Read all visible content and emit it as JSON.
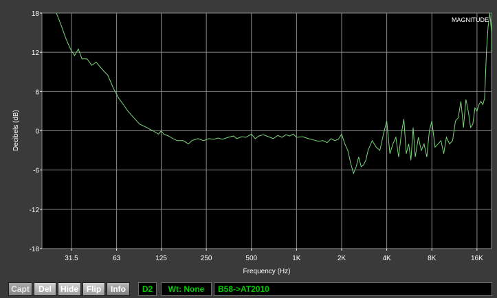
{
  "chart_data": {
    "type": "line",
    "title": "MAGNITUDE",
    "xlabel": "Frequency (Hz)",
    "ylabel": "Decibels (dB)",
    "x_scale": "log",
    "xlim": [
      20,
      20000
    ],
    "ylim": [
      -18,
      18
    ],
    "x_ticks": [
      31.5,
      63,
      125,
      250,
      500,
      1000,
      2000,
      4000,
      8000,
      16000
    ],
    "x_tick_labels": [
      "31.5",
      "63",
      "125",
      "250",
      "500",
      "1K",
      "2K",
      "4K",
      "8K",
      "16K"
    ],
    "y_ticks": [
      18,
      12,
      6,
      0,
      -6,
      -12,
      -18
    ],
    "y_tick_labels": [
      "18",
      "12",
      "6",
      "0",
      "-6",
      "-12",
      "-18"
    ],
    "grid": true,
    "colors": {
      "background": "#000000",
      "grid": "#8c8c8c",
      "line": "#7cd67c",
      "text": "#ffffff"
    },
    "series": [
      {
        "x": [
          25,
          27,
          29,
          31,
          33,
          35,
          37,
          40,
          43,
          46,
          50,
          55,
          60,
          65,
          70,
          75,
          82,
          90,
          100,
          110,
          120,
          125,
          130,
          140,
          150,
          160,
          175,
          190,
          200,
          220,
          240,
          260,
          280,
          300,
          320,
          350,
          380,
          400,
          430,
          460,
          500,
          530,
          560,
          600,
          650,
          700,
          750,
          800,
          850,
          900,
          950,
          1000,
          1100,
          1200,
          1300,
          1400,
          1500,
          1600,
          1700,
          1800,
          1900,
          2000,
          2100,
          2200,
          2300,
          2400,
          2500,
          2600,
          2700,
          2800,
          2900,
          3000,
          3200,
          3400,
          3600,
          3800,
          4000,
          4200,
          4400,
          4600,
          4800,
          5000,
          5200,
          5400,
          5600,
          5800,
          6000,
          6200,
          6500,
          6800,
          7100,
          7400,
          7700,
          8000,
          8400,
          8800,
          9200,
          9600,
          10000,
          10500,
          11000,
          11500,
          12000,
          12500,
          13000,
          13500,
          14000,
          14500,
          15000,
          15500,
          16000,
          16500,
          17000,
          17500,
          18000,
          18500,
          19000,
          19500,
          20000,
          20500,
          21000
        ],
        "y": [
          18,
          16,
          14,
          12.5,
          11.5,
          12.5,
          11,
          11,
          10,
          10.5,
          9.5,
          8.5,
          6.5,
          5,
          4,
          3,
          2,
          1,
          0.5,
          0,
          -0.5,
          0,
          -0.5,
          -0.8,
          -1.2,
          -1.5,
          -1.5,
          -2,
          -1.5,
          -1.2,
          -1.5,
          -1.2,
          -1.3,
          -1.1,
          -1.3,
          -1,
          -0.8,
          -1.2,
          -0.9,
          -1,
          -0.5,
          -1.2,
          -0.8,
          -0.6,
          -0.9,
          -1.2,
          -0.7,
          -1,
          -0.6,
          -0.8,
          -0.5,
          -1,
          -0.9,
          -1.2,
          -1.4,
          -1.6,
          -1.5,
          -1.8,
          -1.2,
          -1.5,
          -1.3,
          -0.5,
          -2,
          -3,
          -5,
          -6.5,
          -5.5,
          -4,
          -5.5,
          -5.2,
          -4.5,
          -3,
          -1.5,
          -2.5,
          -3,
          -0.5,
          1.5,
          -3.5,
          -2,
          -1,
          -4,
          -0.5,
          1.8,
          -3.5,
          -2,
          -4.5,
          0.5,
          -4,
          -1,
          -3,
          -2,
          -4,
          0,
          1.5,
          -2.5,
          -2,
          -1.5,
          -3.5,
          -1,
          -2,
          -1.5,
          1.5,
          2,
          4.5,
          0.5,
          4.8,
          3,
          0.5,
          1,
          3.5,
          3,
          4,
          4.5,
          4,
          5,
          12,
          16,
          18,
          15,
          17,
          12
        ]
      }
    ]
  },
  "toolbar": {
    "capt": "Capt",
    "del": "Del",
    "hide": "Hide",
    "flip": "Flip",
    "info": "Info",
    "curve_id": "D2",
    "weighting": "Wt: None",
    "curve_name": "B58->AT2010"
  }
}
